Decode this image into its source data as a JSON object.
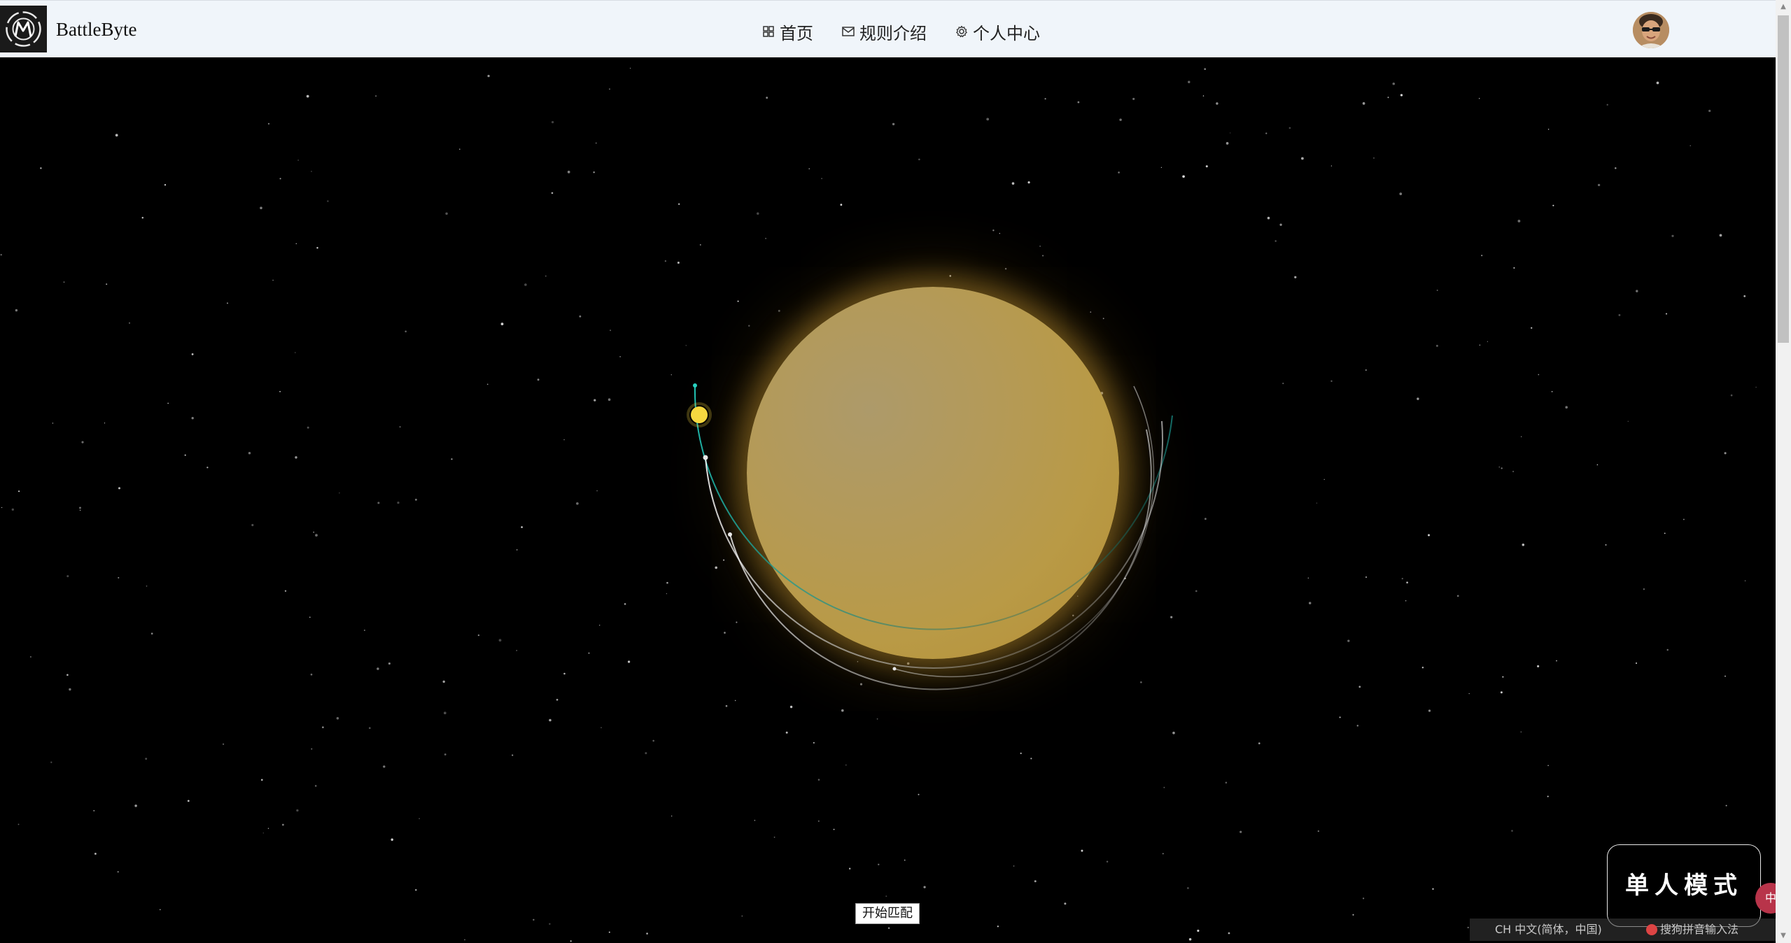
{
  "navbar": {
    "brand": "BattleByte",
    "logo_icon": "battlebyte-logo",
    "menu": [
      {
        "label": "首页",
        "icon": "grid-icon"
      },
      {
        "label": "规则介绍",
        "icon": "mail-icon"
      },
      {
        "label": "个人中心",
        "icon": "gear-icon"
      }
    ],
    "avatar_icon": "user-avatar"
  },
  "scene": {
    "background_color": "#000000",
    "sun_color": "#b99a46",
    "orbit_accent_color": "#1aa7a0"
  },
  "actions": {
    "start_match_label": "开始匹配",
    "single_mode_label": "单人模式"
  },
  "ime": {
    "language": "CH 中文(简体，中国)",
    "input_method": "搜狗拼音输入法",
    "float_label": "中"
  }
}
